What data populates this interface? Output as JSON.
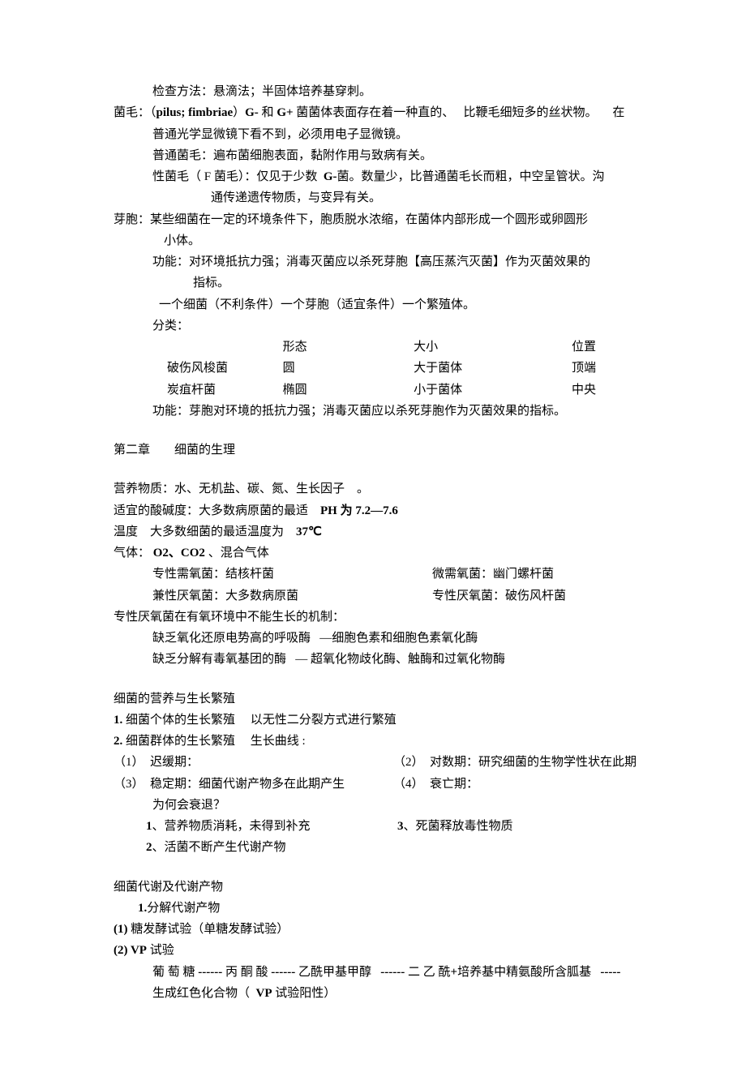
{
  "l1": "检查方法：悬滴法；半固体培养基穿刺。",
  "l2a": "菌毛：（",
  "l2b": "pilus; fimbriae",
  "l2c": "）",
  "l2d": "G-",
  "l2e": " 和 ",
  "l2f": "G+",
  "l2g": " 菌菌体表面存在着一种直的、",
  "l2h": "比鞭毛细短多的丝状物。",
  "l2i": "在",
  "l3": "普通光学显微镜下看不到，必须用电子显微镜。",
  "l4": "普通菌毛：遍布菌细胞表面，黏附作用与致病有关。",
  "l5a": "性菌毛（",
  "l5b": " F 菌毛）：仅见于少数",
  "l5c": "G-菌。数量少，比普通菌毛长而粗，中空呈管状。沟",
  "l6": "通传递遗传物质，与变异有关。",
  "l7": "芽胞：某些细菌在一定的环境条件下，胞质脱水浓缩，在菌体内部形成一个圆形或卵圆形",
  "l8": "小体。",
  "l9": "功能：对环境抵抗力强；消毒灭菌应以杀死芽胞【高压蒸汽灭菌】作为灭菌效果的",
  "l10": "指标。",
  "l11": "一个细菌（不利条件）一个芽胞（适宜条件）一个繁殖体。",
  "l12": "分类：",
  "t_h1": "形态",
  "t_h2": "大小",
  "t_h3": "位置",
  "t_r1c1": "破伤风梭菌",
  "t_r1c2": "圆",
  "t_r1c3": "大于菌体",
  "t_r1c4": "顶端",
  "t_r2c1": "炭疽杆菌",
  "t_r2c2": "椭圆",
  "t_r2c3": "小于菌体",
  "t_r2c4": "中央",
  "l13": "功能：芽胞对环境的抵抗力强；消毒灭菌应以杀死芽胞作为灭菌效果的指标。",
  "ch2": "第二章　　细菌的生理",
  "n1": "营养物质：水、无机盐、碳、氮、生长因子",
  "n1b": "。",
  "n2a": "适宜的酸碱度：大多数病原菌的最适",
  "n2b": "PH 为 7.2—7.6",
  "n3a": "温度",
  "n3b": "大多数细菌的最适温度为",
  "n3c": "37℃",
  "n4a": "气体：",
  "n4b": " O2、CO2",
  "n4c": " 、混合气体",
  "n5a": "专性需氧菌：结核杆菌",
  "n5b": "微需氧菌：幽门螺杆菌",
  "n6a": "兼性厌氧菌：大多数病原菌",
  "n6b": "专性厌氧菌：破伤风杆菌",
  "n7": "专性厌氧菌在有氧环境中不能生长的机制：",
  "n8a": "缺乏氧化还原电势高的呼吸酶",
  "n8b": "—细胞色素和细胞色素氧化酶",
  "n9a": "缺乏分解有毒氧基团的酶",
  "n9b": "— 超氧化物歧化酶、触酶和过氧化物酶",
  "s1": "细菌的营养与生长繁殖",
  "s2a": "1.",
  "s2b": "细菌个体的生长繁殖",
  "s2c": "以无性二分裂方式进行繁殖",
  "s3a": "2.",
  "s3b": "细菌群体的生长繁殖",
  "s3c": "生长曲线  :",
  "s4a": "（1）",
  "s4b": "迟缓期：",
  "s4c": "（2）",
  "s4d": "对数期：研究细菌的生物学性状在此期",
  "s5a": "（3）",
  "s5b": "稳定期：细菌代谢产物多在此期产生",
  "s5c": "（4）",
  "s5d": "衰亡期：",
  "s6": "为何会衰退？",
  "s7a": "1、营养物质消耗，未得到补充",
  "s7b": "3、死菌释放毒性物质",
  "s8": "2、活菌不断产生代谢产物",
  "m1": "细菌代谢及代谢产物",
  "m2": "1.分解代谢产物",
  "m3a": "(1)",
  "m3b": "糖发酵试验（单糖发酵试验）",
  "m4a": "(2) VP",
  "m4b": "试验",
  "m5a": "葡  萄  糖",
  "m5b": " ------ ",
  "m5c": "丙  酮  酸",
  "m5d": " ------ ",
  "m5e": "乙酰甲基甲醇",
  "m5f": " ------ ",
  "m5g": "二  乙  酰",
  "m5h": "+培养基中精氨酸所含胍基",
  "m5i": "-----",
  "m6a": "生成红色化合物（",
  "m6b": "VP 试验阳性）"
}
